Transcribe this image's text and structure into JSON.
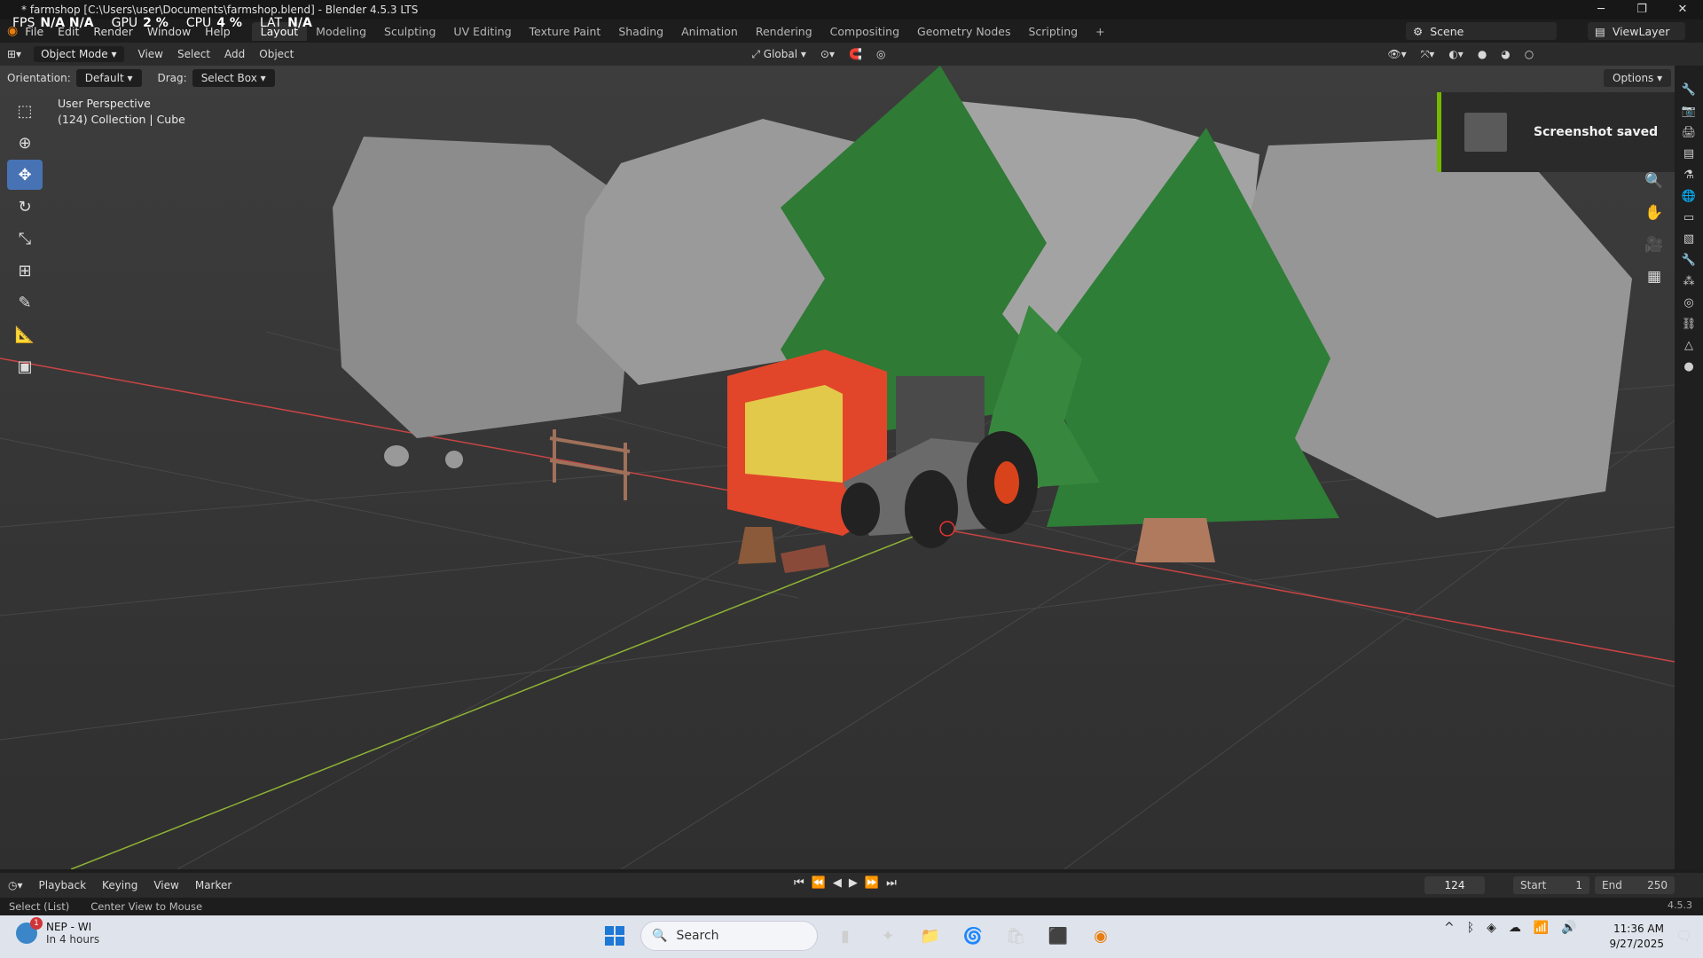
{
  "window": {
    "title": "* farmshop [C:\\Users\\user\\Documents\\farmshop.blend] - Blender 4.5.3 LTS",
    "controls": [
      "─",
      "❐",
      "✕"
    ]
  },
  "perf": {
    "fps_label": "FPS",
    "fps": "N/A N/A",
    "gpu_label": "GPU",
    "gpu": "2 %",
    "cpu_label": "CPU",
    "cpu": "4 %",
    "lat_label": "LAT",
    "lat": "N/A"
  },
  "menus": [
    "File",
    "Edit",
    "Render",
    "Window",
    "Help"
  ],
  "workspaces": [
    "Layout",
    "Modeling",
    "Sculpting",
    "UV Editing",
    "Texture Paint",
    "Shading",
    "Animation",
    "Rendering",
    "Compositing",
    "Geometry Nodes",
    "Scripting"
  ],
  "scene": "Scene",
  "view_layer": "ViewLayer",
  "header": {
    "mode": "Object Mode",
    "items": [
      "View",
      "Select",
      "Add",
      "Object"
    ],
    "transform_orientation": "Global"
  },
  "tool_settings": {
    "orientation_label": "Orientation:",
    "orientation_value": "Default",
    "drag_label": "Drag:",
    "drag_value": "Select Box",
    "options": "Options"
  },
  "viewport": {
    "perspective": "User Perspective",
    "collection": "(124) Collection | Cube"
  },
  "toast": {
    "message": "Screenshot saved",
    "accent": "#76b900"
  },
  "timeline": {
    "menus": [
      "Playback",
      "Keying",
      "View",
      "Marker"
    ],
    "current_frame": "124",
    "start_label": "Start",
    "start": "1",
    "end_label": "End",
    "end": "250"
  },
  "statusbar": {
    "hint1": "Select (List)",
    "hint2": "Center View to Mouse",
    "version": "4.5.3"
  },
  "taskbar": {
    "weather_title": "NEP - WI",
    "weather_sub": "In 4 hours",
    "weather_badge": "1",
    "search_placeholder": "Search",
    "time": "11:36 AM",
    "date": "9/27/2025"
  },
  "colors": {
    "accent_blue": "#4772b3",
    "axis_red": "#c84444",
    "axis_green": "#8fb334"
  }
}
